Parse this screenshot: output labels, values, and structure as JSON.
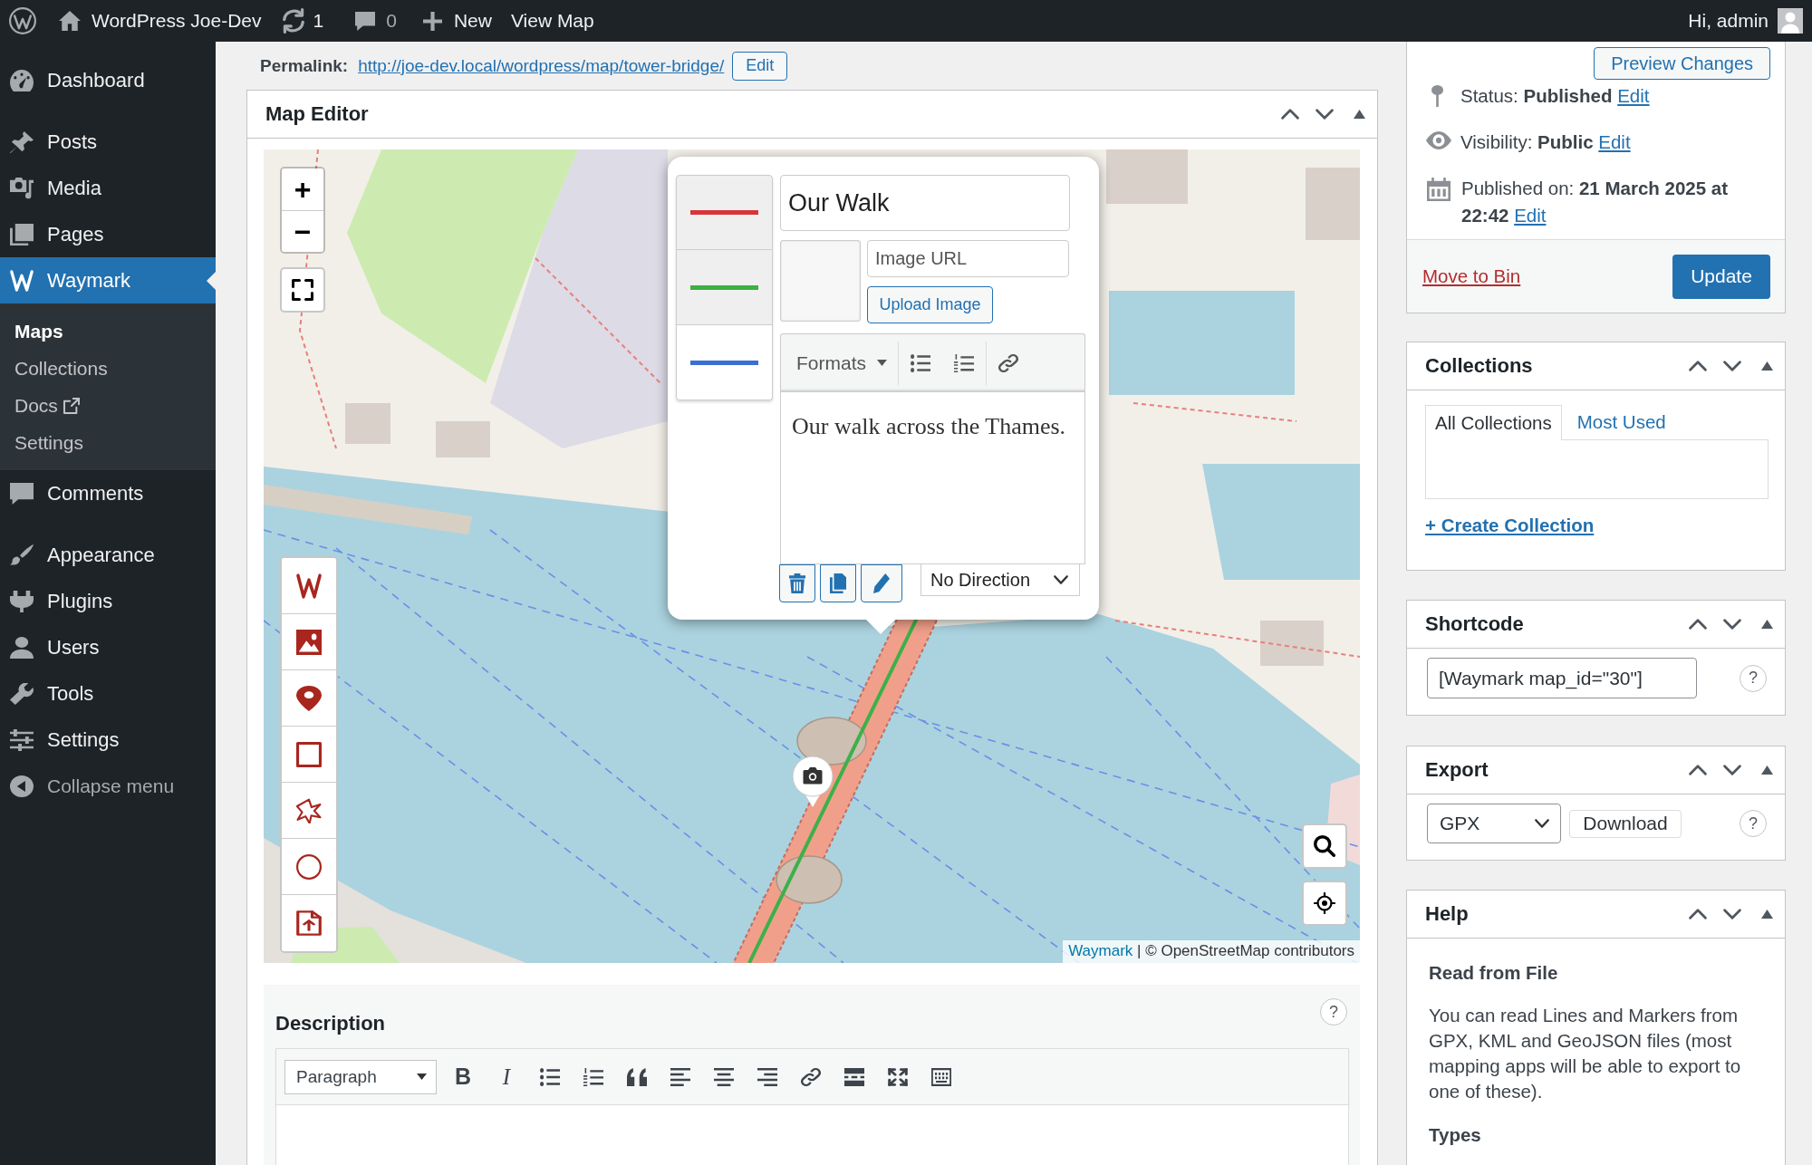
{
  "admin_bar": {
    "site_name": "WordPress Joe-Dev",
    "updates_count": "1",
    "comments_count": "0",
    "new_label": "New",
    "view_label": "View Map",
    "greeting": "Hi, admin"
  },
  "sidebar": {
    "groups": [
      [
        {
          "label": "Dashboard",
          "selected": false
        }
      ],
      [
        {
          "label": "Posts",
          "selected": false
        },
        {
          "label": "Media",
          "selected": false
        },
        {
          "label": "Pages",
          "selected": false
        },
        {
          "label": "Waymark",
          "selected": true,
          "children": [
            {
              "label": "Maps",
              "selected": true,
              "external": false
            },
            {
              "label": "Collections",
              "selected": false,
              "external": false
            },
            {
              "label": "Docs",
              "selected": false,
              "external": true
            },
            {
              "label": "Settings",
              "selected": false,
              "external": false
            }
          ]
        },
        {
          "label": "Comments",
          "selected": false
        }
      ],
      [
        {
          "label": "Appearance",
          "selected": false
        },
        {
          "label": "Plugins",
          "selected": false
        },
        {
          "label": "Users",
          "selected": false
        },
        {
          "label": "Tools",
          "selected": false
        },
        {
          "label": "Settings",
          "selected": false
        }
      ]
    ],
    "collapse_label": "Collapse menu"
  },
  "permalink": {
    "label": "Permalink:",
    "url": "http://joe-dev.local/wordpress/map/tower-bridge/",
    "edit_button": "Edit"
  },
  "map_editor": {
    "title": "Map Editor",
    "map": {
      "zoom_in": "+",
      "zoom_out": "−",
      "popup": {
        "types": [
          {
            "color": "#d63638",
            "selected": false
          },
          {
            "color": "#3cb043",
            "selected": false
          },
          {
            "color": "#3b6fd4",
            "selected": true
          }
        ],
        "title": "Our Walk",
        "image_url_placeholder": "Image URL",
        "upload_button": "Upload Image",
        "formats_label": "Formats",
        "text": "Our walk across the Thames.",
        "direction": "No Direction"
      },
      "attribution_link": "Waymark",
      "attribution_text": "| © OpenStreetMap contributors"
    },
    "description": {
      "label": "Description",
      "help": "?",
      "block_format": "Paragraph",
      "bold_label": "B",
      "italic_label": "I"
    }
  },
  "publish": {
    "preview_button": "Preview Changes",
    "rows": [
      {
        "kind": "status",
        "text": "Status: **Published**",
        "link": "Edit"
      },
      {
        "kind": "visibility",
        "text": "Visibility: **Public**",
        "link": "Edit"
      },
      {
        "kind": "published_on",
        "text": "Published on: **21 March 2025 at 22:42**",
        "link": "Edit"
      }
    ],
    "move_to_bin": "Move to Bin",
    "update_button": "Update"
  },
  "collections": {
    "title": "Collections",
    "tabs": [
      {
        "label": "All Collections",
        "selected": true
      },
      {
        "label": "Most Used",
        "selected": false
      }
    ],
    "create_link": "+ Create Collection"
  },
  "shortcode": {
    "title": "Shortcode",
    "value": "[Waymark map_id=\"30\"]",
    "help": "?"
  },
  "export": {
    "title": "Export",
    "format": "GPX",
    "download_button": "Download",
    "help": "?"
  },
  "help": {
    "title": "Help",
    "blocks": [
      {
        "kind": "heading",
        "text": "Read from File"
      },
      {
        "kind": "paragraph",
        "text": "You can read Lines and Markers from GPX, KML and GeoJSON files (most mapping apps will be able to export to one of these)."
      },
      {
        "kind": "heading",
        "text": "Types"
      }
    ]
  }
}
